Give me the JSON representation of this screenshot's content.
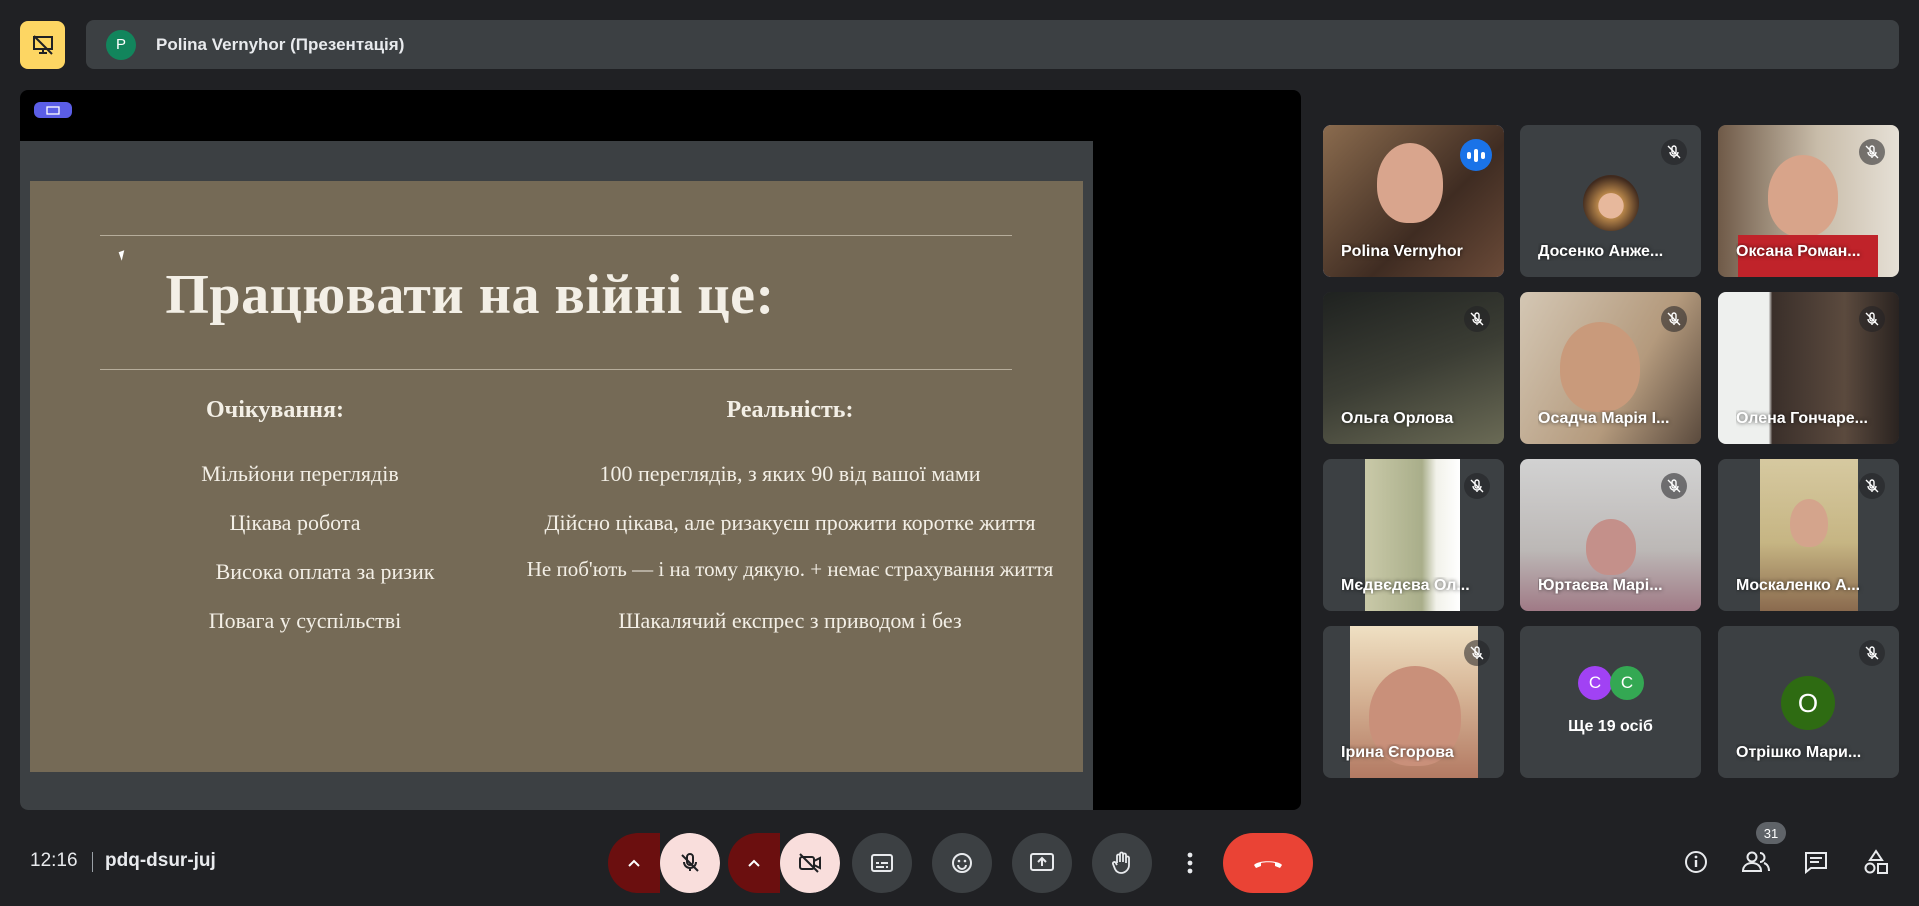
{
  "header": {
    "presenter_initial": "P",
    "title": "Polina Vernyhor (Презентація)"
  },
  "slide": {
    "title": "Працювати на війні це:",
    "left_heading": "Очікування:",
    "right_heading": "Реальність:",
    "expectations": [
      "Мільйони переглядів",
      "Цікава робота",
      "Висока оплата за ризик",
      "Повага у суспільстві"
    ],
    "reality": [
      "100 переглядів, з яких 90 від вашої мами",
      "Дійсно цікава, але ризакуєш прожити коротке життя",
      "Не поб'ють — і на тому дякую. + немає страхування життя",
      "Шакалячий експрес з приводом і без"
    ]
  },
  "participants": [
    {
      "name": "Polina Vernyhor",
      "state": "speaking"
    },
    {
      "name": "Досенко Анже...",
      "state": "muted"
    },
    {
      "name": "Оксана Роман...",
      "state": "muted"
    },
    {
      "name": "Ольга Орлова",
      "state": "muted"
    },
    {
      "name": "Осадча Марія І...",
      "state": "muted"
    },
    {
      "name": "Олена Гончаре...",
      "state": "muted"
    },
    {
      "name": "Мєдвєдєва Ол...",
      "state": "muted"
    },
    {
      "name": "Юртаєва Марі...",
      "state": "muted"
    },
    {
      "name": "Москаленко А...",
      "state": "muted"
    },
    {
      "name": "Ірина Єгорова",
      "state": "muted"
    },
    {
      "name": "Отрішко Мари...",
      "state": "muted"
    }
  ],
  "others_tile": {
    "initials": [
      "С",
      "С"
    ],
    "label": "Ще 19 осіб"
  },
  "last_avatar_initial": "О",
  "footer": {
    "time": "12:16",
    "meeting_code": "pdq-dsur-juj",
    "people_count": "31"
  },
  "colors": {
    "accent": "#8ab4f8",
    "end_call": "#ea4335",
    "present_button": "#fdd663"
  }
}
